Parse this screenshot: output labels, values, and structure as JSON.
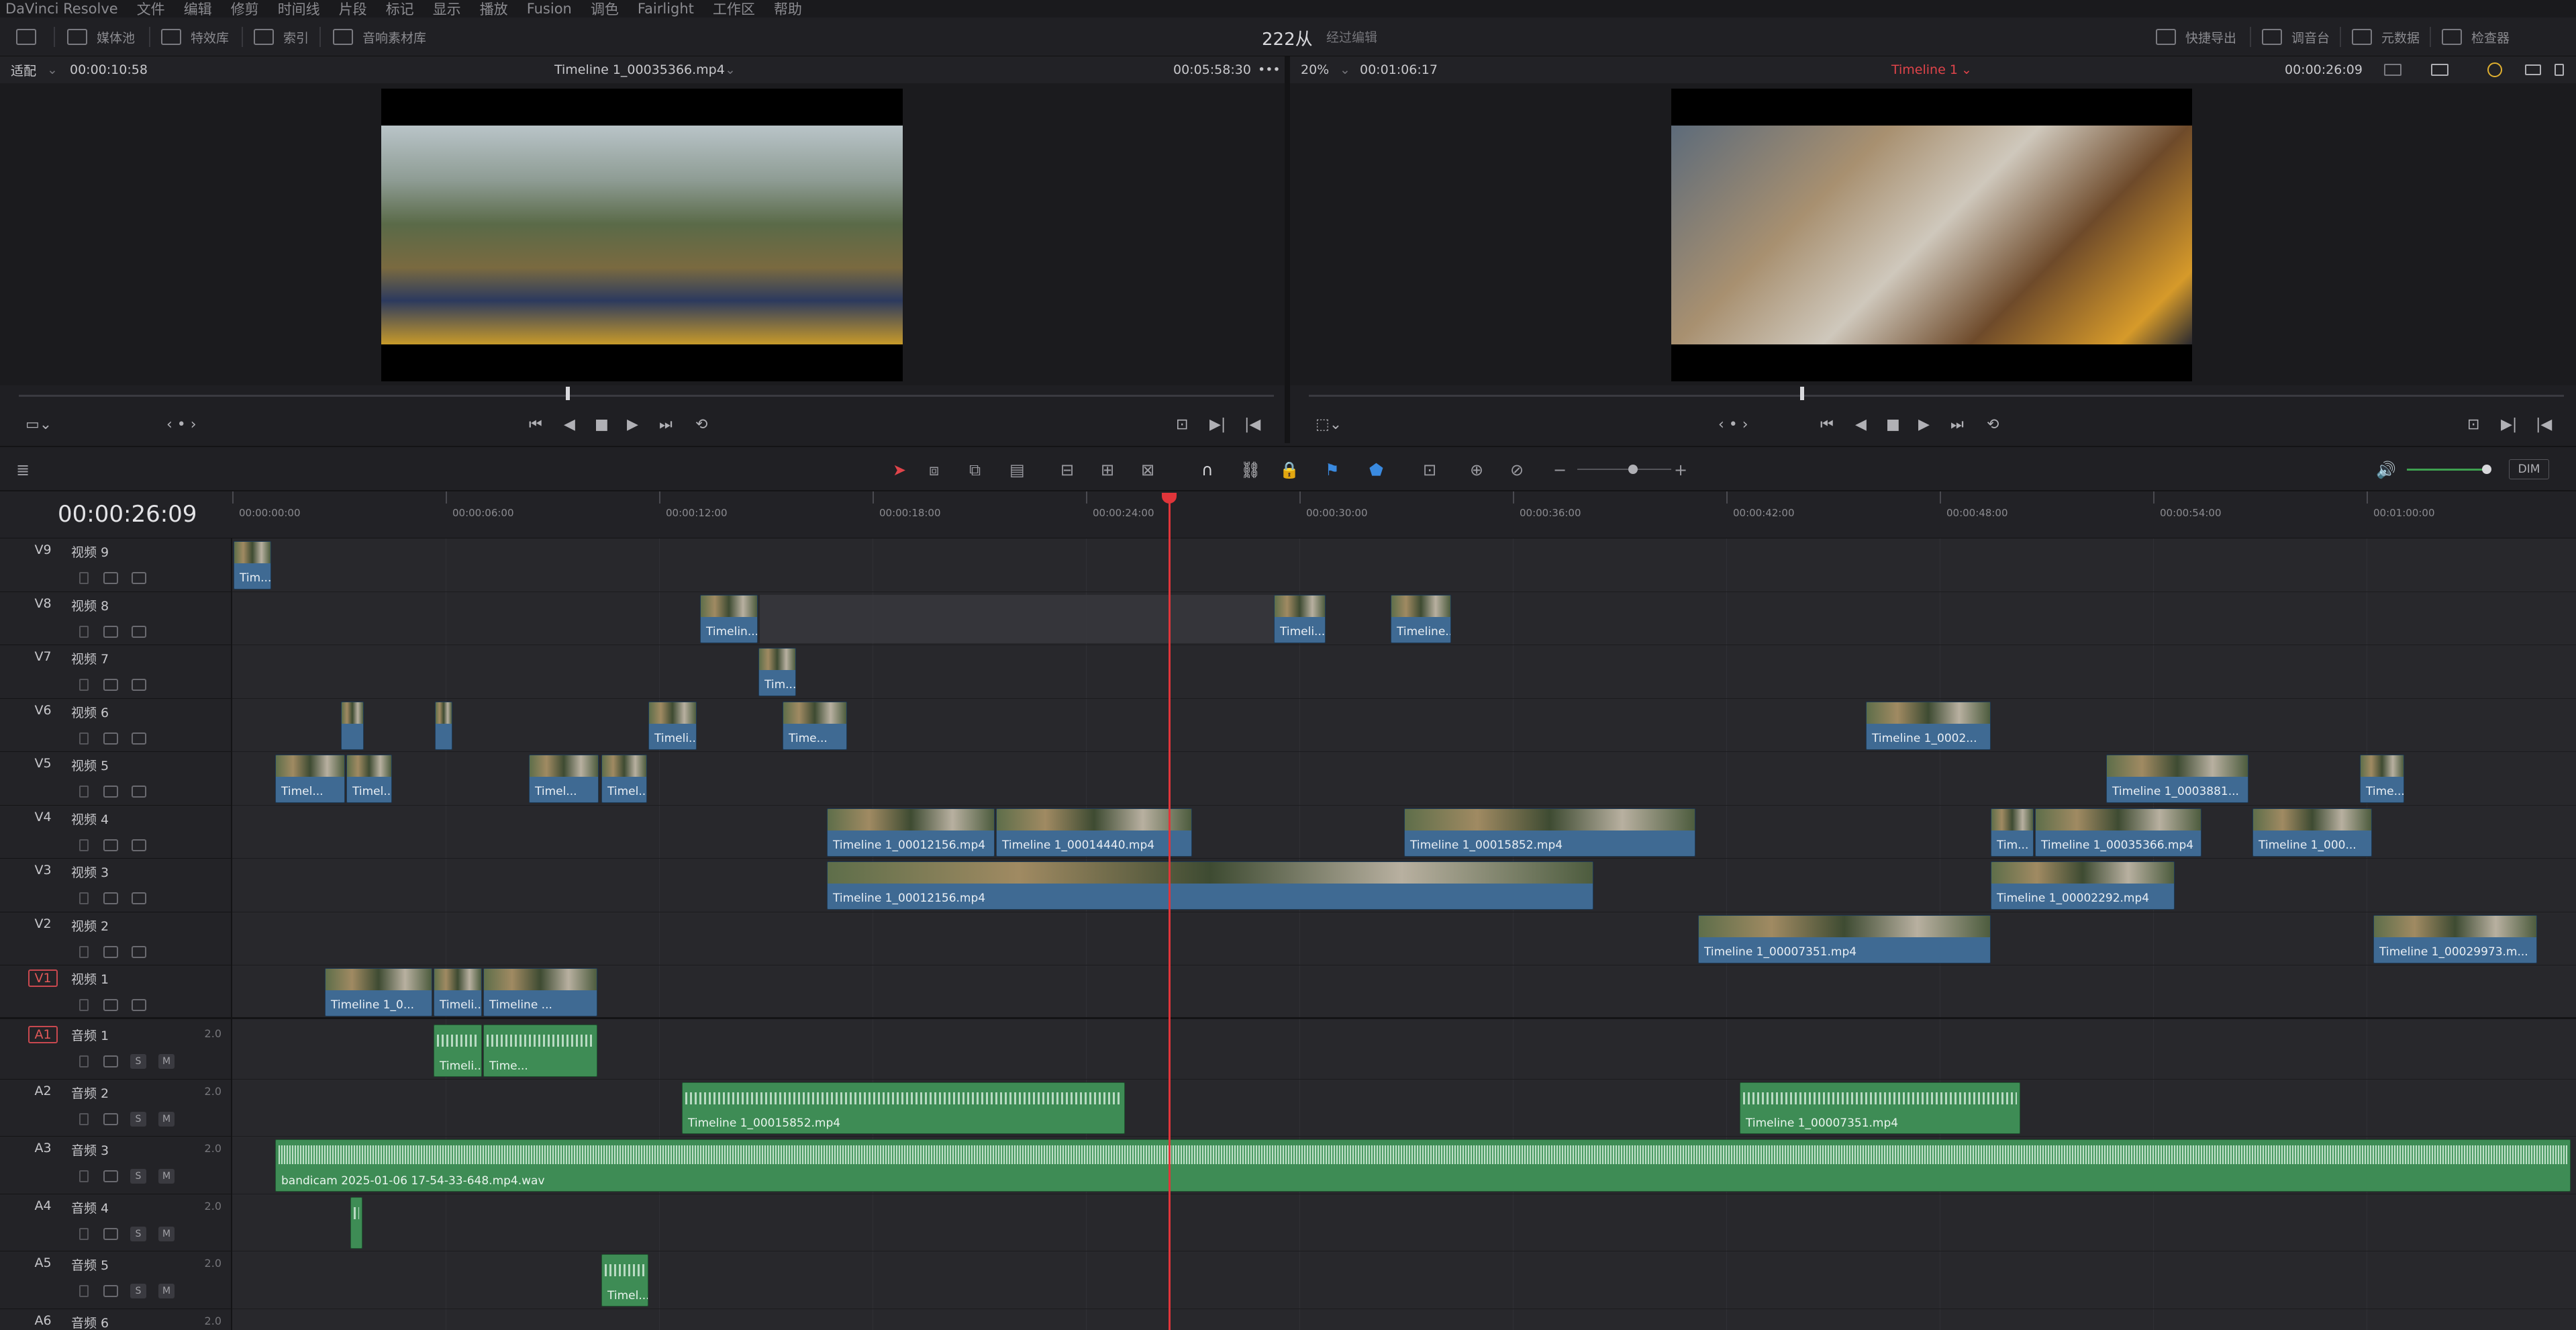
{
  "menu": [
    "DaVinci Resolve",
    "文件",
    "编辑",
    "修剪",
    "时间线",
    "片段",
    "标记",
    "显示",
    "播放",
    "Fusion",
    "调色",
    "Fairlight",
    "工作区",
    "帮助"
  ],
  "toolbar": {
    "media_pool": "媒体池",
    "effects": "特效库",
    "index": "索引",
    "sound_library": "音响素材库",
    "project_title": "222从",
    "project_status": "经过编辑",
    "quick_export": "快捷导出",
    "mixer": "调音台",
    "metadata": "元数据",
    "inspector": "检查器"
  },
  "source_viewer": {
    "fit": "适配",
    "timecode_in": "00:00:10:58",
    "clip_name": "Timeline 1_00035366.mp4",
    "duration": "00:05:58:30",
    "more": "•••"
  },
  "timeline_viewer": {
    "zoom": "20%",
    "timecode_in": "00:01:06:17",
    "timeline_name": "Timeline 1",
    "timecode_current": "00:00:26:09"
  },
  "timeline": {
    "current_timecode": "00:00:26:09",
    "dim_label": "DIM",
    "ruler": [
      "00:00:00:00",
      "00:00:06:00",
      "00:00:12:00",
      "00:00:18:00",
      "00:00:24:00",
      "00:00:30:00",
      "00:00:36:00",
      "00:00:42:00",
      "00:00:48:00",
      "00:00:54:00",
      "00:01:00:00"
    ],
    "video_tracks": [
      {
        "id": "V9",
        "name": "视频 9"
      },
      {
        "id": "V8",
        "name": "视频 8"
      },
      {
        "id": "V7",
        "name": "视频 7"
      },
      {
        "id": "V6",
        "name": "视频 6"
      },
      {
        "id": "V5",
        "name": "视频 5"
      },
      {
        "id": "V4",
        "name": "视频 4"
      },
      {
        "id": "V3",
        "name": "视频 3"
      },
      {
        "id": "V2",
        "name": "视频 2"
      },
      {
        "id": "V1",
        "name": "视频 1"
      }
    ],
    "audio_tracks": [
      {
        "id": "A1",
        "name": "音频 1",
        "level": "2.0"
      },
      {
        "id": "A2",
        "name": "音频 2",
        "level": "2.0"
      },
      {
        "id": "A3",
        "name": "音频 3",
        "level": "2.0"
      },
      {
        "id": "A4",
        "name": "音频 4",
        "level": "2.0"
      },
      {
        "id": "A5",
        "name": "音频 5",
        "level": "2.0"
      },
      {
        "id": "A6",
        "name": "音频 6",
        "level": "2.0"
      }
    ],
    "solo_label": "S",
    "mute_label": "M",
    "clips": {
      "v9_a": "Tim...",
      "v8_a": "Timelin...",
      "v8_b": "Timeli...",
      "v8_c": "Timeline...",
      "v7_a": "Tim...",
      "v6_a": "Timeli...",
      "v6_b": "Time...",
      "v6_c": "Timeline 1_0002...",
      "v5_a": "Timel...",
      "v5_b": "Timel...",
      "v5_c": "Timel...",
      "v5_d": "Timel...",
      "v5_e": "Timeline 1_0003881...",
      "v5_f": "Time...",
      "v4_a": "Timeline 1_00012156.mp4",
      "v4_b": "Timeline 1_00014440.mp4",
      "v4_c": "Timeline 1_00015852.mp4",
      "v4_d": "Tim...",
      "v4_e": "Timeline 1_00035366.mp4",
      "v4_f": "Timeline 1_000...",
      "v3_a": "Timeline 1_00012156.mp4",
      "v3_b": "Timeline 1_00002292.mp4",
      "v2_a": "Timeline 1_00007351.mp4",
      "v2_b": "Timeline 1_00029973.m...",
      "v1_a": "Timeline 1_0...",
      "v1_b": "Timeli...",
      "v1_c": "Timeline ...",
      "a1_a": "Timeli...",
      "a1_b": "Time...",
      "a2_a": "Timeline 1_00015852.mp4",
      "a2_b": "Timeline 1_00007351.mp4",
      "a3_a": "bandicam 2025-01-06 17-54-33-648.mp4.wav",
      "a5_a": "Timel..."
    }
  }
}
